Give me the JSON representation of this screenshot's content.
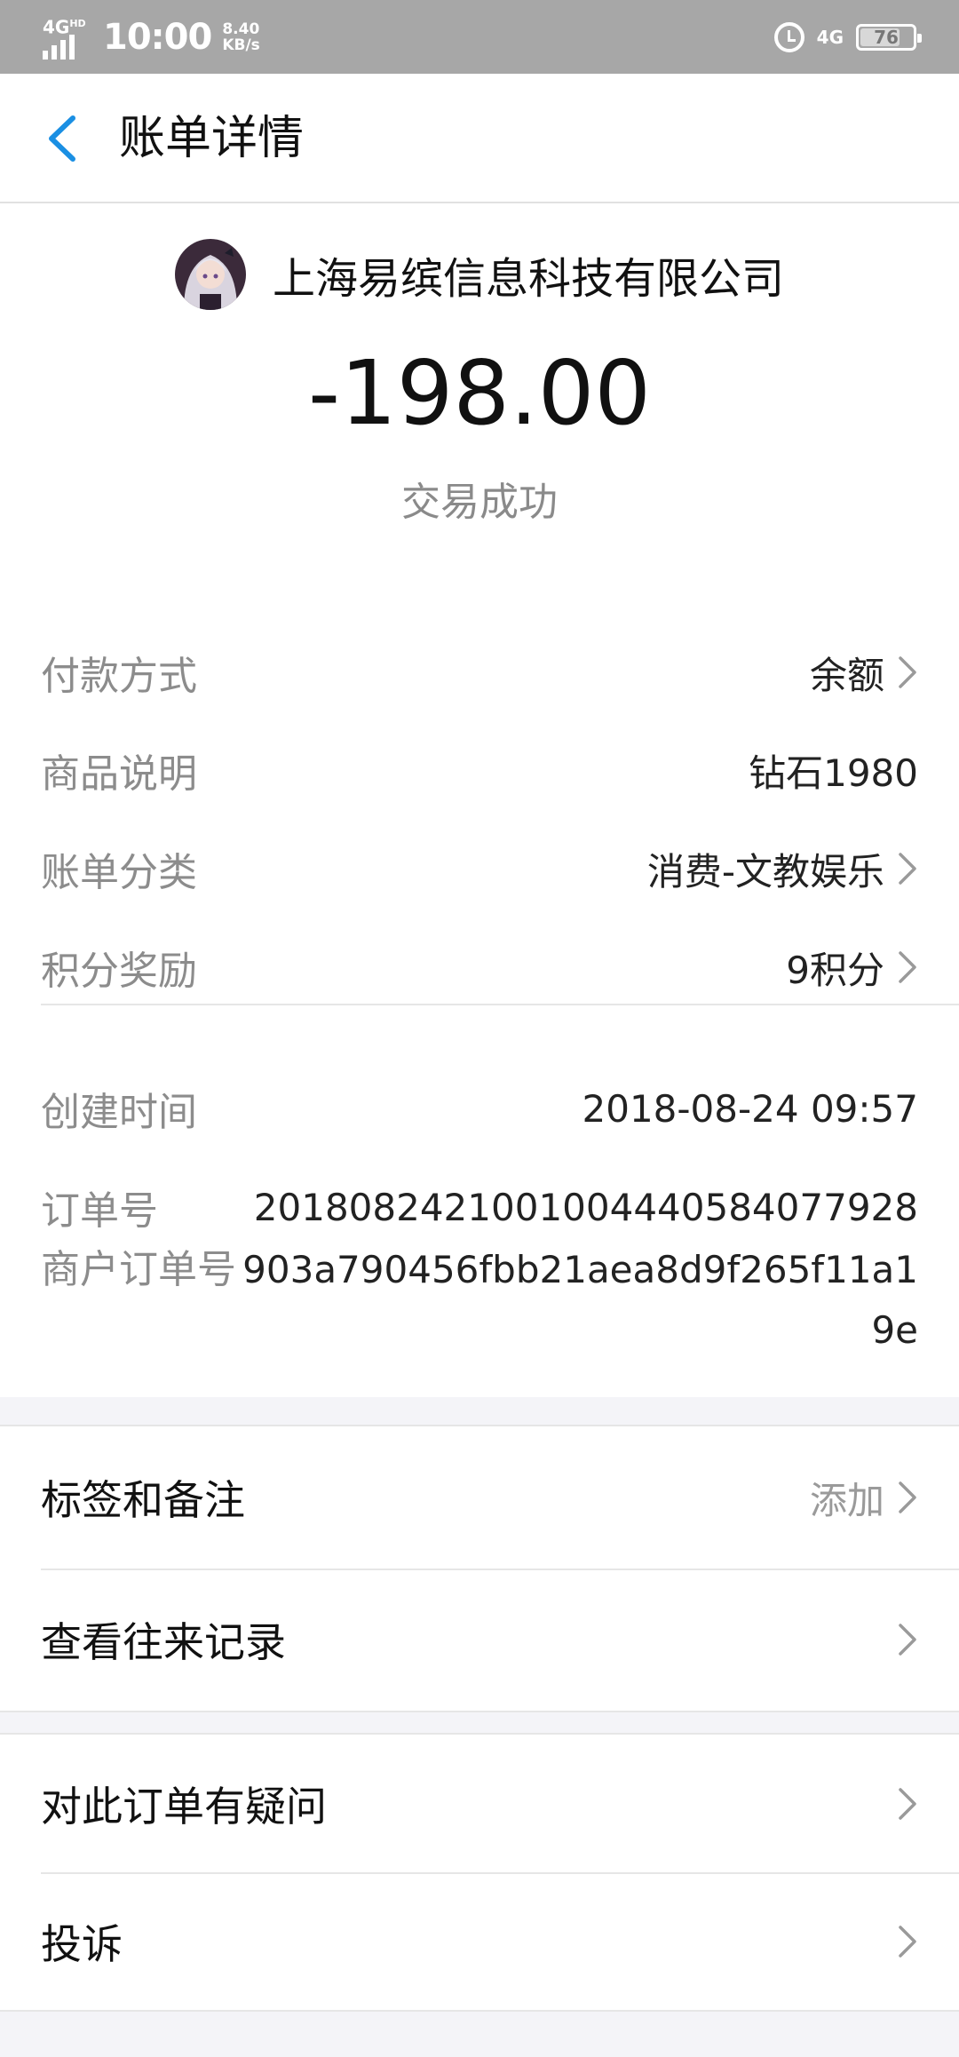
{
  "status_bar": {
    "network": "4G",
    "network_sup": "HD",
    "time": "10:00",
    "speed_value": "8.40",
    "speed_unit": "KB/s",
    "network_right": "4G",
    "battery": "76",
    "battery_level": 0.76
  },
  "header": {
    "title": "账单详情"
  },
  "summary": {
    "merchant": "上海易缤信息科技有限公司",
    "amount": "-198.00",
    "status": "交易成功"
  },
  "details": [
    {
      "label": "付款方式",
      "value": "余额"
    },
    {
      "label": "商品说明",
      "value": "钻石1980"
    },
    {
      "label": "账单分类",
      "value": "消费-文教娱乐"
    },
    {
      "label": "积分奖励",
      "value": "9积分"
    }
  ],
  "order": {
    "created_label": "创建时间",
    "created_value": "2018-08-24 09:57",
    "order_no_label": "订单号",
    "order_no_value": "2018082421001004440584077928",
    "merchant_order_label": "商户订单号",
    "merchant_order_value": "903a790456fbb21aea8d9f265f11a19e"
  },
  "actions": {
    "tags_label": "标签和备注",
    "tags_value": "添加",
    "history_label": "查看往来记录",
    "question_label": "对此订单有疑问",
    "complaint_label": "投诉"
  },
  "colors": {
    "accent": "#1a8fe3",
    "status_bar": "#a7a7a7"
  }
}
